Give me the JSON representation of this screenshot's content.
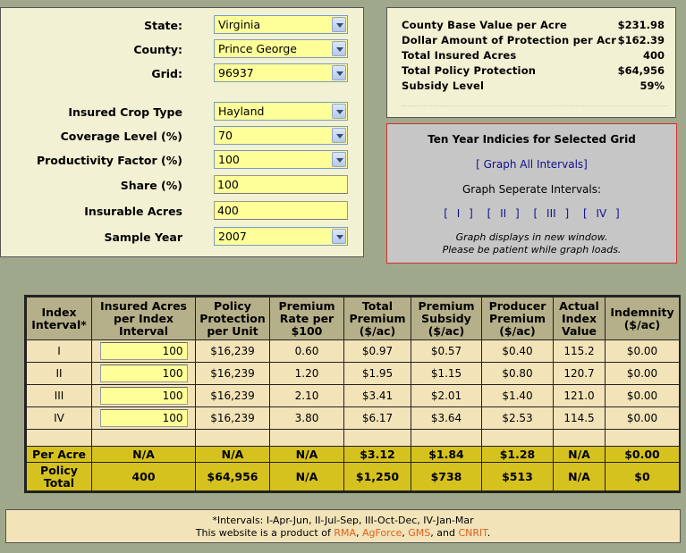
{
  "form": {
    "state_label": "State:",
    "state_value": "Virginia",
    "county_label": "County:",
    "county_value": "Prince George",
    "grid_label": "Grid:",
    "grid_value": "96937",
    "crop_label": "Insured Crop Type",
    "crop_value": "Hayland",
    "coverage_label": "Coverage Level (%)",
    "coverage_value": "70",
    "productivity_label": "Productivity Factor (%)",
    "productivity_value": "100",
    "share_label": "Share (%)",
    "share_value": "100",
    "acres_label": "Insurable Acres",
    "acres_value": "400",
    "year_label": "Sample Year",
    "year_value": "2007"
  },
  "summary": [
    {
      "label": "County Base Value per Acre",
      "value": "$231.98"
    },
    {
      "label": "Dollar Amount of Protection per Acre",
      "value": "$162.39"
    },
    {
      "label": "Total Insured Acres",
      "value": "400"
    },
    {
      "label": "Total Policy Protection",
      "value": "$64,956"
    },
    {
      "label": "Subsidy Level",
      "value": "59%"
    }
  ],
  "graph": {
    "title": "Ten Year Indicies for Selected Grid",
    "all_link": "[ Graph All Intervals]",
    "separate_label": "Graph Seperate Intervals:",
    "links": [
      "[ I ]",
      "[ II ]",
      "[ III ]",
      "[ IV ]"
    ],
    "note1": "Graph displays in new window.",
    "note2": "Please be patient while graph loads."
  },
  "table": {
    "headers": [
      "Index Interval*",
      "Insured Acres per Index Interval",
      "Policy Protection per Unit",
      "Premium Rate per $100",
      "Total Premium ($/ac)",
      "Premium Subsidy ($/ac)",
      "Producer Premium ($/ac)",
      "Actual Index Value",
      "Indemnity ($/ac)"
    ],
    "rows": [
      {
        "interval": "I",
        "acres": "100",
        "protection": "$16,239",
        "rate": "0.60",
        "total": "$0.97",
        "subsidy": "$0.57",
        "producer": "$0.40",
        "index": "115.2",
        "indemnity": "$0.00"
      },
      {
        "interval": "II",
        "acres": "100",
        "protection": "$16,239",
        "rate": "1.20",
        "total": "$1.95",
        "subsidy": "$1.15",
        "producer": "$0.80",
        "index": "120.7",
        "indemnity": "$0.00"
      },
      {
        "interval": "III",
        "acres": "100",
        "protection": "$16,239",
        "rate": "2.10",
        "total": "$3.41",
        "subsidy": "$2.01",
        "producer": "$1.40",
        "index": "121.0",
        "indemnity": "$0.00"
      },
      {
        "interval": "IV",
        "acres": "100",
        "protection": "$16,239",
        "rate": "3.80",
        "total": "$6.17",
        "subsidy": "$3.64",
        "producer": "$2.53",
        "index": "114.5",
        "indemnity": "$0.00"
      }
    ],
    "per_acre": {
      "label": "Per Acre",
      "acres": "N/A",
      "protection": "N/A",
      "rate": "N/A",
      "total": "$3.12",
      "subsidy": "$1.84",
      "producer": "$1.28",
      "index": "N/A",
      "indemnity": "$0.00"
    },
    "policy_total": {
      "label": "Policy Total",
      "acres": "400",
      "protection": "$64,956",
      "rate": "N/A",
      "total": "$1,250",
      "subsidy": "$738",
      "producer": "$513",
      "index": "N/A",
      "indemnity": "$0"
    }
  },
  "footer": {
    "intervals": "*Intervals: I-Apr-Jun, II-Jul-Sep, III-Oct-Dec, IV-Jan-Mar",
    "product_prefix": "This website is a product of",
    "links": [
      "RMA",
      "AgForce",
      "GMS",
      "CNRIT"
    ],
    "sep1": ",",
    "sep2": ",",
    "sep3": ", and",
    "end": "."
  }
}
